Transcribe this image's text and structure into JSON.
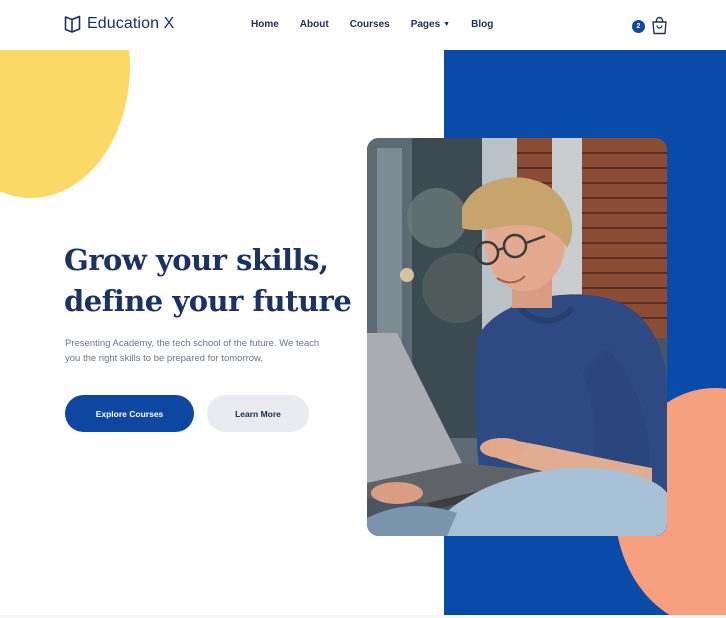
{
  "header": {
    "brand": {
      "name": "Education X",
      "icon": "book-open-icon"
    },
    "nav": [
      {
        "label": "Home"
      },
      {
        "label": "About"
      },
      {
        "label": "Courses"
      },
      {
        "label": "Pages",
        "has_dropdown": true
      },
      {
        "label": "Blog"
      }
    ],
    "cart": {
      "count": "2",
      "icon": "shopping-bag-icon"
    }
  },
  "hero": {
    "title_line1": "Grow your skills,",
    "title_line2": "define your future",
    "description_line1": "Presenting Academy, the tech school of the future. We teach",
    "description_line2": "you the right skills to be prepared for tomorrow.",
    "primary_button": "Explore Courses",
    "secondary_button": "Learn More",
    "image_subject": "student with glasses using a laptop"
  },
  "colors": {
    "primary": "#0d47a1",
    "panel_blue": "#0a4aa8",
    "accent_yellow": "#fbd967",
    "accent_peach": "#f6a080",
    "heading": "#1b3263"
  }
}
